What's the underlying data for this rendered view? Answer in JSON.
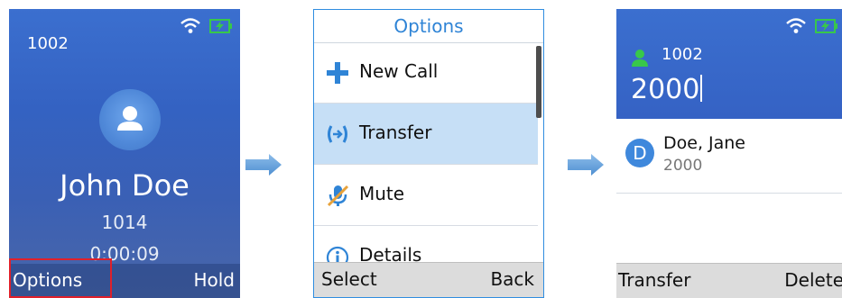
{
  "screen_in_call": {
    "extension": "1002",
    "contact_name": "John Doe",
    "contact_number": "1014",
    "call_timer": "0:00:09",
    "softkey_left": "Options",
    "softkey_right": "Hold"
  },
  "screen_options": {
    "title": "Options",
    "items": [
      {
        "label": "New Call",
        "icon": "plus-icon"
      },
      {
        "label": "Transfer",
        "icon": "transfer-icon",
        "selected": true
      },
      {
        "label": "Mute",
        "icon": "mute-icon"
      },
      {
        "label": "Details",
        "icon": "info-icon"
      }
    ],
    "softkey_left": "Select",
    "softkey_right": "Back"
  },
  "screen_transfer": {
    "extension": "1002",
    "dialed_digits": "2000",
    "result": {
      "initial": "D",
      "name": "Doe, Jane",
      "number": "2000"
    },
    "softkey_left": "Transfer",
    "softkey_right": "Delete"
  },
  "colors": {
    "call_blue": "#3462c2",
    "accent_blue": "#2f84d6",
    "selection": "#c6dff6",
    "highlight_red": "#e0202a",
    "battery_green": "#38c84a",
    "arrow_blue": "#5b9ad9"
  }
}
